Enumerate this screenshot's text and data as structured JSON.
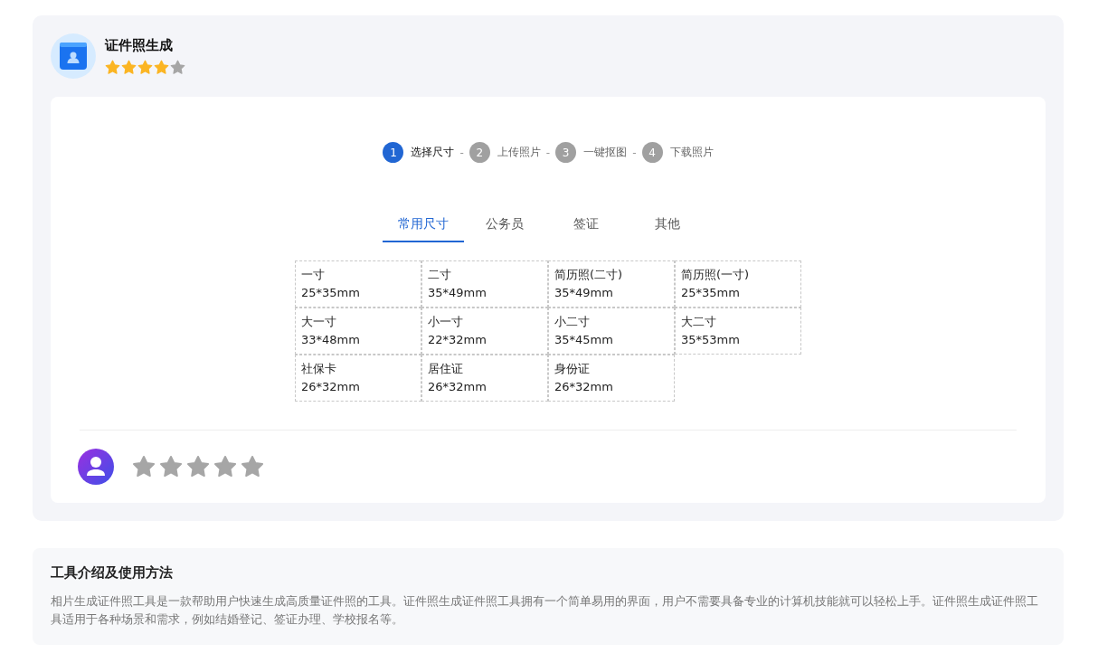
{
  "tool": {
    "title": "证件照生成",
    "stars": 4
  },
  "steps": [
    {
      "number": "1",
      "label": "选择尺寸",
      "selected": true
    },
    {
      "number": "2",
      "label": "上传照片",
      "selected": false
    },
    {
      "number": "3",
      "label": "一键抠图",
      "selected": false
    },
    {
      "number": "4",
      "label": "下载照片",
      "selected": false
    }
  ],
  "step_separator": "-",
  "tabs": [
    {
      "label": "常用尺寸",
      "selected": true
    },
    {
      "label": "公务员",
      "selected": false
    },
    {
      "label": "签证",
      "selected": false
    },
    {
      "label": "其他",
      "selected": false
    }
  ],
  "sizes": [
    {
      "name": "一寸",
      "dimensions": "25*35mm"
    },
    {
      "name": "二寸",
      "dimensions": "35*49mm"
    },
    {
      "name": "简历照(二寸)",
      "dimensions": "35*49mm"
    },
    {
      "name": "简历照(一寸)",
      "dimensions": "25*35mm"
    },
    {
      "name": "大一寸",
      "dimensions": "33*48mm"
    },
    {
      "name": "小一寸",
      "dimensions": "22*32mm"
    },
    {
      "name": "小二寸",
      "dimensions": "35*45mm"
    },
    {
      "name": "大二寸",
      "dimensions": "35*53mm"
    },
    {
      "name": "社保卡",
      "dimensions": "26*32mm"
    },
    {
      "name": "居住证",
      "dimensions": "26*32mm"
    },
    {
      "name": "身份证",
      "dimensions": "26*32mm"
    }
  ],
  "user_rating": {
    "stars": 0
  },
  "intro": {
    "title": "工具介绍及使用方法",
    "text": "相片生成证件照工具是一款帮助用户快速生成高质量证件照的工具。证件照生成证件照工具拥有一个简单易用的界面，用户不需要具备专业的计算机技能就可以轻松上手。证件照生成证件照工具适用于各种场景和需求，例如结婚登记、签证办理、学校报名等。"
  }
}
